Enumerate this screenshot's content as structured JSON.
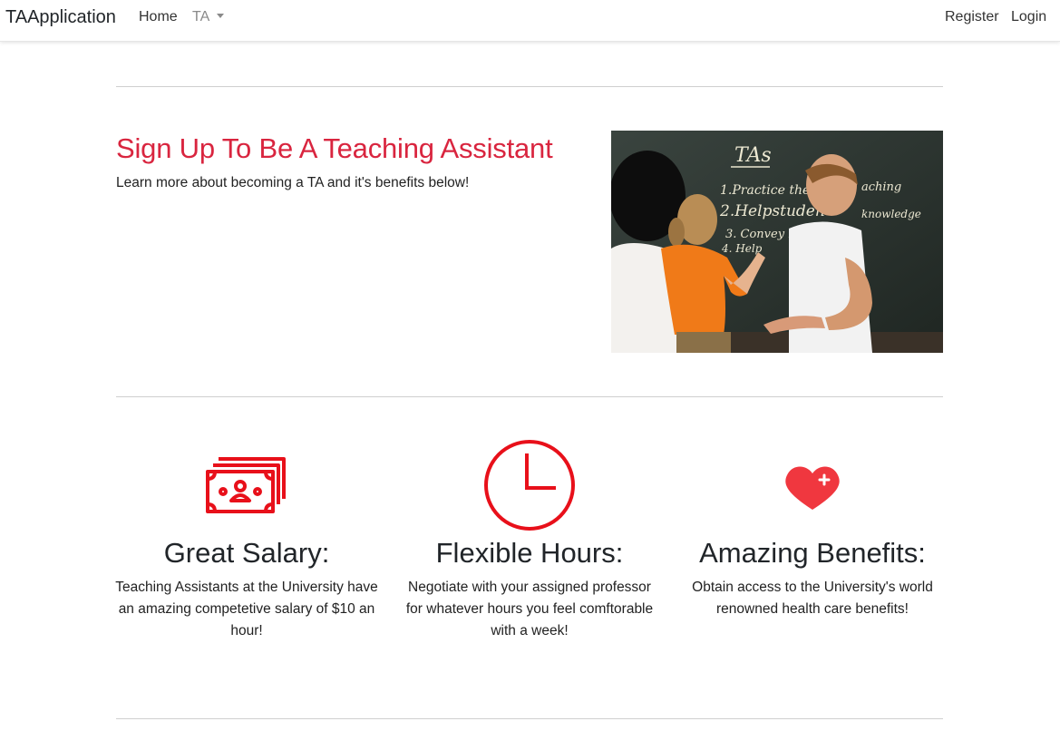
{
  "navbar": {
    "brand": "TAApplication",
    "links": {
      "home": "Home",
      "ta": "TA",
      "register": "Register",
      "login": "Login"
    }
  },
  "hero": {
    "title": "Sign Up To Be A Teaching Assistant",
    "subtitle": "Learn more about becoming a TA and it's benefits below!",
    "chalkboard": {
      "heading": "TAs",
      "lines": [
        "1.Practice the s",
        "aching",
        "2.Helpstuden",
        "knowledge",
        "3. Convey love of dis",
        "4. Help"
      ]
    }
  },
  "features": [
    {
      "icon": "money-icon",
      "title": "Great Salary:",
      "text": "Teaching Assistants at the University have an amazing competetive salary of $10 an hour!"
    },
    {
      "icon": "clock-icon",
      "title": "Flexible Hours:",
      "text": "Negotiate with your assigned professor for whatever hours you feel comftorable with a week!"
    },
    {
      "icon": "heart-plus-icon",
      "title": "Amazing Benefits:",
      "text": "Obtain access to the University's world renowned health care benefits!"
    }
  ],
  "colors": {
    "accent": "#d9253f",
    "icon_red": "#e8101a",
    "heart_red": "#f0373f"
  }
}
